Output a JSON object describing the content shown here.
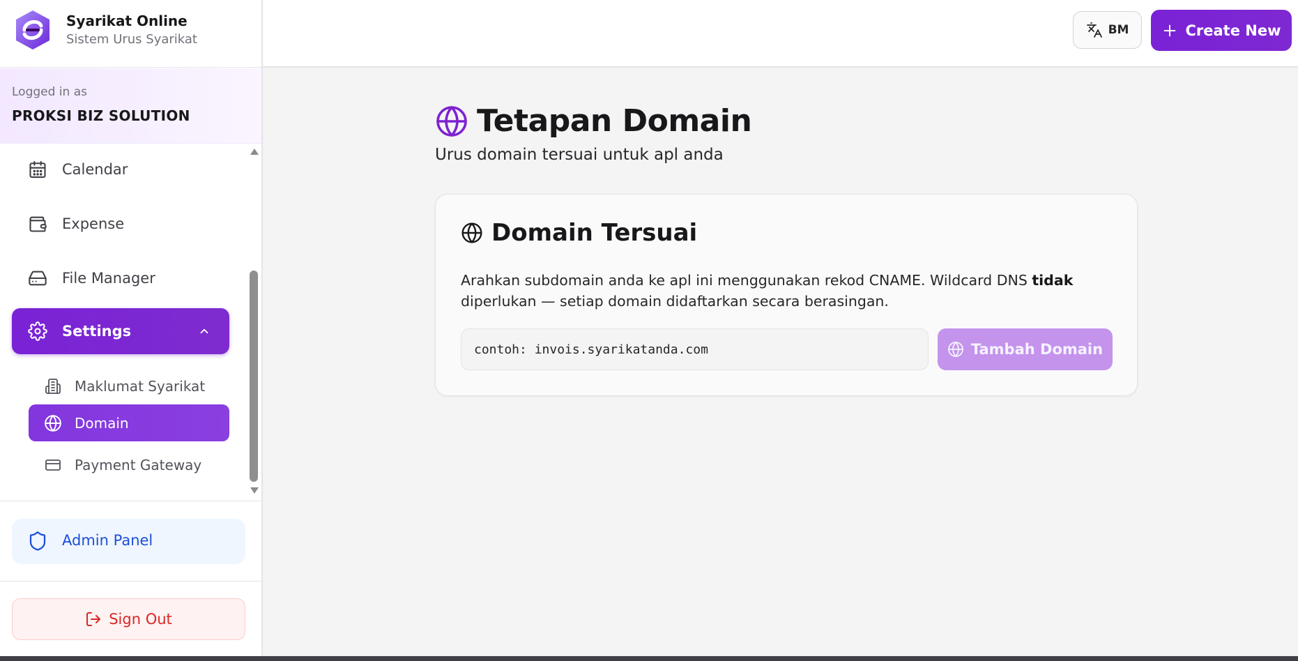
{
  "brand": {
    "name": "Syarikat Online",
    "subtitle": "Sistem Urus Syarikat"
  },
  "user": {
    "logged_in_label": "Logged in as",
    "company_name": "PROKSI BIZ SOLUTION"
  },
  "sidebar": {
    "items": [
      {
        "label": "Calendar",
        "icon": "calendar-icon"
      },
      {
        "label": "Expense",
        "icon": "wallet-icon"
      },
      {
        "label": "File Manager",
        "icon": "hard-drive-icon"
      },
      {
        "label": "Settings",
        "icon": "gear-icon",
        "active": true,
        "expanded": true
      }
    ],
    "settings_subitems": [
      {
        "label": "Maklumat Syarikat",
        "icon": "building-icon"
      },
      {
        "label": "Domain",
        "icon": "globe-icon",
        "active": true
      },
      {
        "label": "Payment Gateway",
        "icon": "credit-card-icon"
      }
    ],
    "admin_panel_label": "Admin Panel",
    "sign_out_label": "Sign Out"
  },
  "topbar": {
    "language_label": "BM",
    "create_new_label": "Create New"
  },
  "page": {
    "title": "Tetapan Domain",
    "subtitle": "Urus domain tersuai untuk apl anda"
  },
  "custom_domain_card": {
    "title": "Domain Tersuai",
    "description_part1": "Arahkan subdomain anda ke apl ini menggunakan rekod CNAME. Wildcard DNS ",
    "description_bold": "tidak",
    "description_part2": " diperlukan — setiap domain didaftarkan secara berasingan.",
    "input_placeholder": "contoh: invois.syarikatanda.com",
    "input_value": "",
    "add_button_label": "Tambah Domain"
  },
  "colors": {
    "accent": "#7e22ce",
    "accent_light": "#c493ec",
    "admin_blue": "#1d4ed8",
    "danger": "#dc2626"
  }
}
